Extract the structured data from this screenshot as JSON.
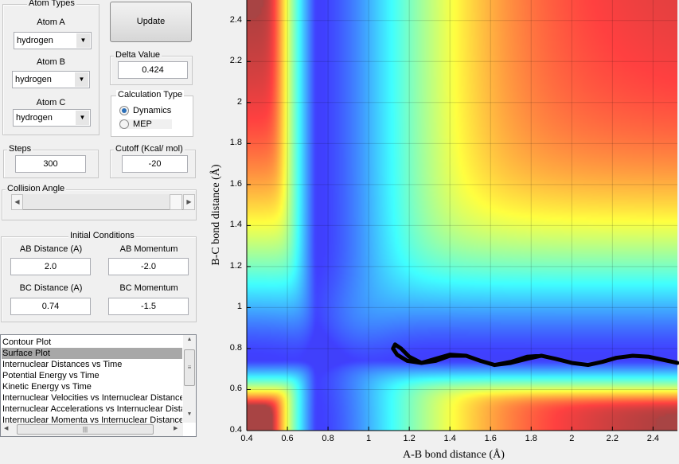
{
  "atom_types": {
    "title": "Atom Types",
    "atom_a_label": "Atom A",
    "atom_a_value": "hydrogen",
    "atom_b_label": "Atom B",
    "atom_b_value": "hydrogen",
    "atom_c_label": "Atom C",
    "atom_c_value": "hydrogen"
  },
  "update_label": "Update",
  "delta": {
    "title": "Delta Value",
    "value": "0.424"
  },
  "calc_type": {
    "title": "Calculation Type",
    "options": [
      "Dynamics",
      "MEP"
    ],
    "selected": "Dynamics"
  },
  "steps": {
    "title": "Steps",
    "value": "300"
  },
  "cutoff": {
    "title": "Cutoff (Kcal/ mol)",
    "value": "-20"
  },
  "collision_angle": {
    "title": "Collision Angle",
    "slider_fraction": 0.0
  },
  "initial": {
    "title": "Initial Conditions",
    "ab_dist_label": "AB Distance (A)",
    "ab_dist": "2.0",
    "ab_mom_label": "AB Momentum",
    "ab_mom": "-2.0",
    "bc_dist_label": "BC Distance (A)",
    "bc_dist": "0.74",
    "bc_mom_label": "BC Momentum",
    "bc_mom": "-1.5"
  },
  "plot_list": {
    "items": [
      "Contour Plot",
      "Surface Plot",
      "Internuclear Distances vs Time",
      "Potential Energy vs Time",
      "Kinetic Energy vs Time",
      "Internuclear Velocities vs Internuclear Distance",
      "Internuclear Accelerations vs Internuclear Distance",
      "Internuclear Momenta vs Internuclear Distance"
    ],
    "selected_index": 1
  },
  "plot": {
    "xlabel": "A-B bond distance (Å)",
    "ylabel": "B-C bond distance (Å)",
    "xticks": [
      "0.4",
      "0.6",
      "0.8",
      "1",
      "1.2",
      "1.4",
      "1.6",
      "1.8",
      "2",
      "2.2",
      "2.4"
    ],
    "yticks": [
      "0.4",
      "0.6",
      "0.8",
      "1",
      "1.2",
      "1.4",
      "1.6",
      "1.8",
      "2",
      "2.2",
      "2.4"
    ],
    "xlim": [
      0.4,
      2.52
    ],
    "ylim": [
      0.4,
      2.5
    ],
    "colormap": "jet",
    "cutoff_color": "#a84444",
    "trajectory_color": "#000000",
    "trajectory": [
      [
        2.52,
        0.73
      ],
      [
        2.45,
        0.745
      ],
      [
        2.38,
        0.76
      ],
      [
        2.3,
        0.765
      ],
      [
        2.22,
        0.755
      ],
      [
        2.15,
        0.735
      ],
      [
        2.08,
        0.72
      ],
      [
        2.0,
        0.73
      ],
      [
        1.92,
        0.75
      ],
      [
        1.85,
        0.765
      ],
      [
        1.78,
        0.75
      ],
      [
        1.7,
        0.73
      ],
      [
        1.62,
        0.72
      ],
      [
        1.55,
        0.74
      ],
      [
        1.48,
        0.765
      ],
      [
        1.4,
        0.77
      ],
      [
        1.33,
        0.75
      ],
      [
        1.26,
        0.73
      ],
      [
        1.19,
        0.74
      ],
      [
        1.14,
        0.77
      ],
      [
        1.12,
        0.8
      ],
      [
        1.13,
        0.82
      ],
      [
        1.16,
        0.8
      ],
      [
        1.2,
        0.76
      ],
      [
        1.26,
        0.73
      ],
      [
        1.33,
        0.74
      ],
      [
        1.4,
        0.765
      ],
      [
        1.48,
        0.765
      ],
      [
        1.55,
        0.74
      ],
      [
        1.62,
        0.72
      ],
      [
        1.7,
        0.735
      ],
      [
        1.78,
        0.76
      ],
      [
        1.85,
        0.765
      ],
      [
        1.92,
        0.75
      ]
    ]
  }
}
